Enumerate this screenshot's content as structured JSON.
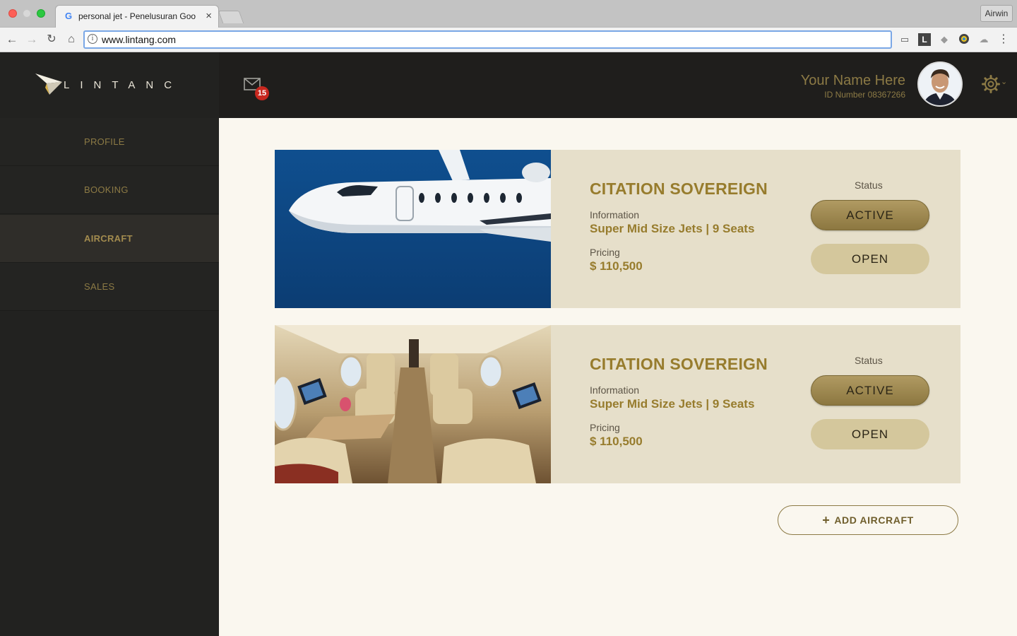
{
  "browser": {
    "tab_title": "personal jet - Penelusuran Goo",
    "tab_favicon": "G",
    "address": "www.lintang.com",
    "profile_name": "Airwin",
    "icons": [
      "back-icon",
      "forward-icon",
      "reload-icon",
      "home-icon",
      "info-icon",
      "extension-icons"
    ]
  },
  "brand": {
    "name": "LINTANG",
    "accent": "#8c7a45",
    "dark": "#222220"
  },
  "sidebar": {
    "items": [
      {
        "label": "PROFILE",
        "active": false
      },
      {
        "label": "BOOKING",
        "active": false
      },
      {
        "label": "AIRCRAFT",
        "active": true
      },
      {
        "label": "SALES",
        "active": false
      }
    ]
  },
  "header": {
    "mail_count": "15",
    "user_name": "Your Name Here",
    "user_id": "ID Number 08367266"
  },
  "aircraft": [
    {
      "title": "CITATION SOVEREIGN",
      "info_label": "Information",
      "info_value": "Super Mid Size Jets | 9 Seats",
      "pricing_label": "Pricing",
      "pricing_value": "$ 110,500",
      "status_label": "Status",
      "status_button": "ACTIVE",
      "open_button": "OPEN",
      "image": "jet-exterior"
    },
    {
      "title": "CITATION SOVEREIGN",
      "info_label": "Information",
      "info_value": "Super Mid Size Jets | 9 Seats",
      "pricing_label": "Pricing",
      "pricing_value": "$ 110,500",
      "status_label": "Status",
      "status_button": "ACTIVE",
      "open_button": "OPEN",
      "image": "jet-interior"
    }
  ],
  "add_button": "ADD AIRCRAFT"
}
